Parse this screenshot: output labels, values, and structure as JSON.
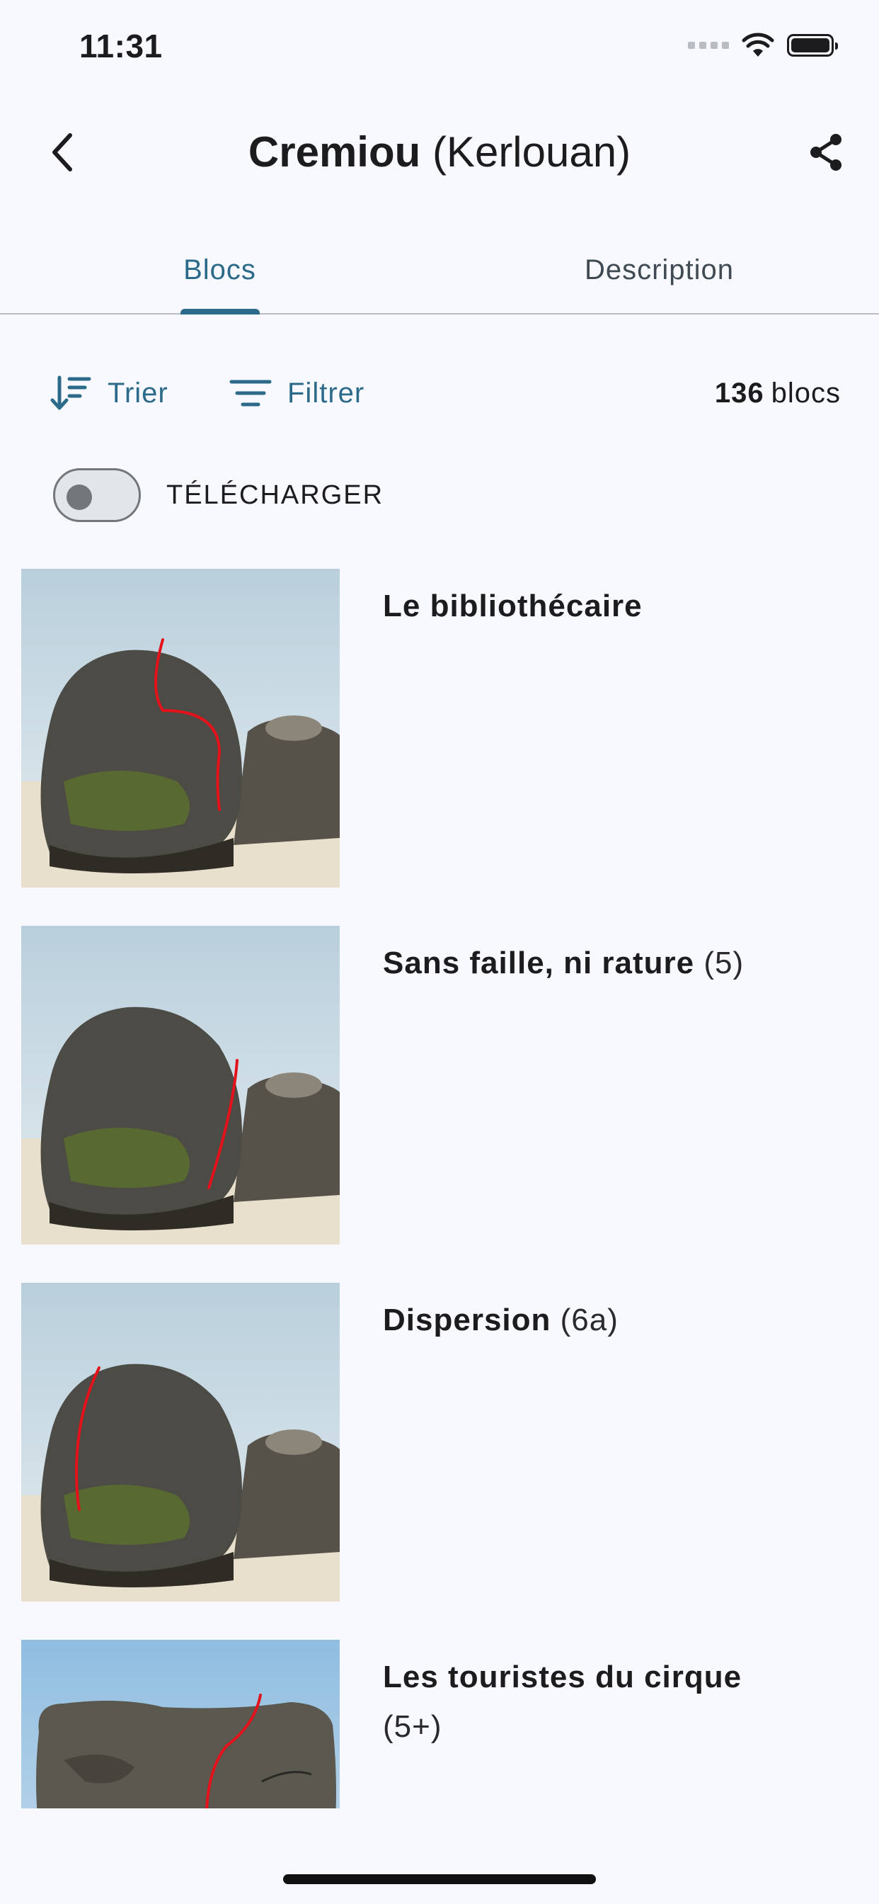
{
  "status_bar": {
    "time": "11:31"
  },
  "header": {
    "name": "Cremiou",
    "region": "(Kerlouan)"
  },
  "tabs": [
    {
      "label": "Blocs",
      "selected": true
    },
    {
      "label": "Description",
      "selected": false
    }
  ],
  "toolbar": {
    "sort_label": "Trier",
    "filter_label": "Filtrer",
    "count_number": "136",
    "count_unit": "blocs"
  },
  "download": {
    "label": "TÉLÉCHARGER",
    "enabled": false
  },
  "items": [
    {
      "name": "Le bibliothécaire",
      "grade": ""
    },
    {
      "name": "Sans faille, ni rature",
      "grade": "(5)"
    },
    {
      "name": "Dispersion",
      "grade": "(6a)"
    },
    {
      "name": "Les touristes du cirque",
      "grade": "(5+)"
    }
  ],
  "colors": {
    "accent": "#2c6a89",
    "background": "#f7f9fe",
    "route_line": "#e3121b"
  }
}
